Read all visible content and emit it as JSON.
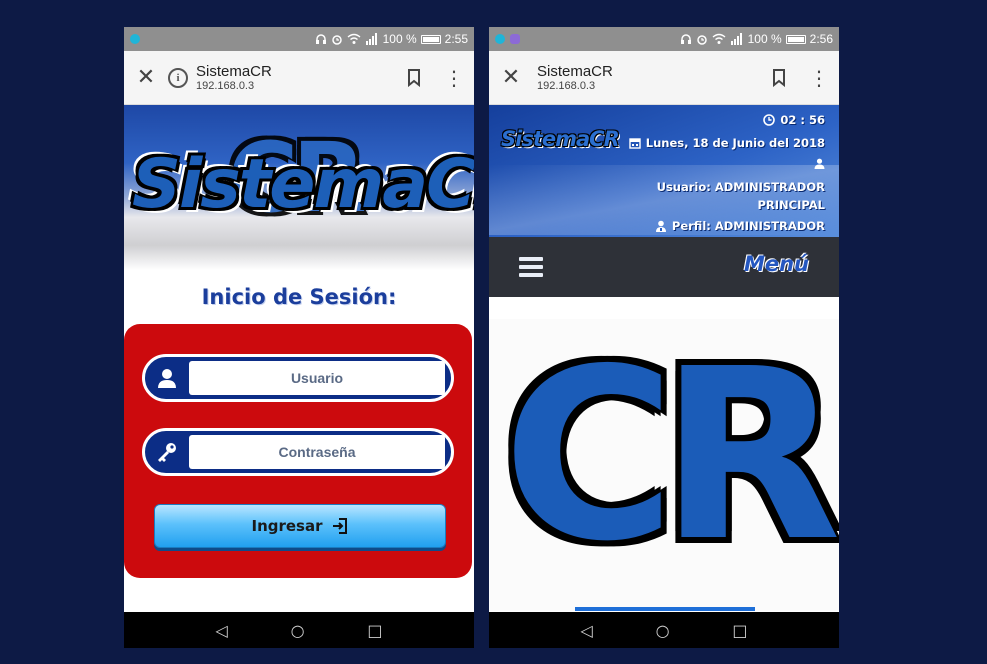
{
  "login_phone": {
    "status": {
      "battery": "100 %",
      "time": "2:55"
    },
    "browser": {
      "close": "✕",
      "title": "SistemaCR",
      "url": "192.168.0.3"
    },
    "logo": {
      "text": "SistemaCR",
      "overlay": "CR"
    },
    "form": {
      "title": "Inicio de Sesión:",
      "user_placeholder": "Usuario",
      "password_placeholder": "Contraseña",
      "submit_label": "Ingresar"
    },
    "nav": {
      "back": "◁",
      "home": "○",
      "recents": "□"
    }
  },
  "dashboard_phone": {
    "status": {
      "battery": "100 %",
      "time": "2:56"
    },
    "browser": {
      "close": "✕",
      "title": "SistemaCR",
      "url": "192.168.0.3"
    },
    "header": {
      "logo": "SistemaCR",
      "clock": "02 : 56",
      "date": "Lunes, 18 de Junio del 2018",
      "user_line1": "Usuario: ADMINISTRADOR",
      "user_line2": "PRINCIPAL",
      "profile": "Perfil: ADMINISTRADOR"
    },
    "menu": {
      "label": "Menú"
    },
    "hero_logo": "CR",
    "nav": {
      "back": "◁",
      "home": "○",
      "recents": "□"
    }
  },
  "colors": {
    "background": "#0d1a45",
    "panel_red": "#cc0a0d",
    "field_blue": "#0c2d86",
    "brand_blue": "#1b5cb8",
    "menu_bar": "#2e3138"
  }
}
